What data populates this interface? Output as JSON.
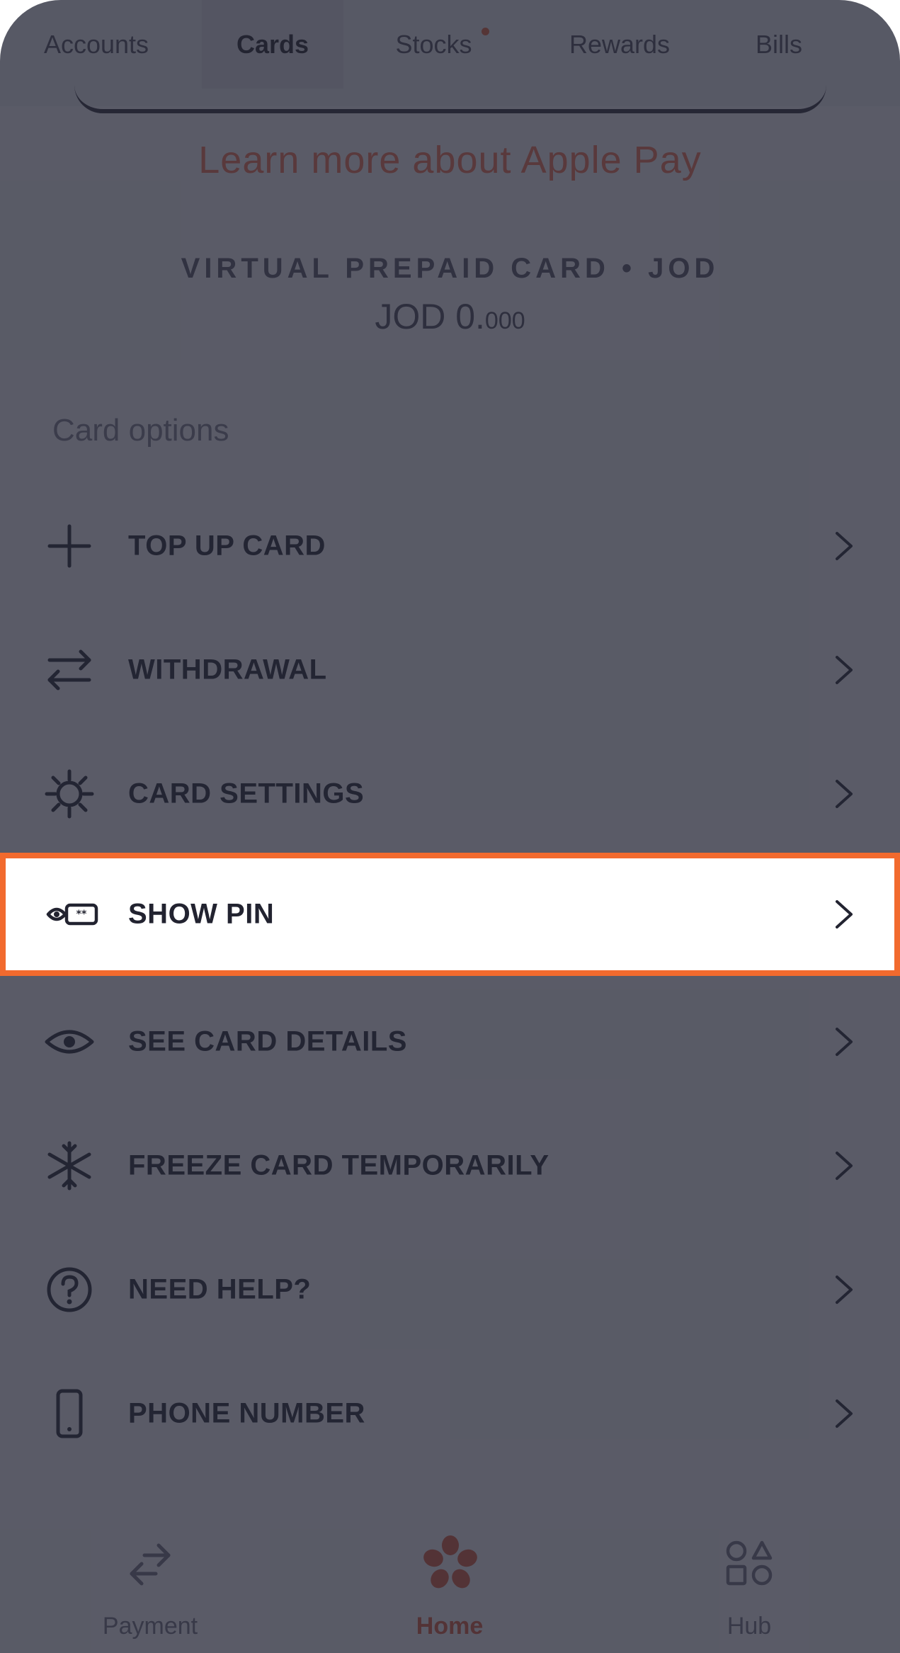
{
  "tabs": [
    {
      "label": "Accounts"
    },
    {
      "label": "Cards"
    },
    {
      "label": "Stocks"
    },
    {
      "label": "Rewards"
    },
    {
      "label": "Bills"
    }
  ],
  "card": {
    "apple_pay_link": "Learn more about Apple Pay",
    "type_label": "VIRTUAL PREPAID CARD  •  JOD",
    "balance_main": "JOD 0.",
    "balance_fraction": "000"
  },
  "card_options": {
    "title": "Card options",
    "items": [
      {
        "label": "TOP UP CARD",
        "icon": "plus-icon"
      },
      {
        "label": "WITHDRAWAL",
        "icon": "transfer-arrows-icon"
      },
      {
        "label": "CARD SETTINGS",
        "icon": "gear-icon"
      },
      {
        "label": "SHOW PIN",
        "icon": "pin-eye-icon"
      },
      {
        "label": "SEE CARD DETAILS",
        "icon": "eye-icon"
      },
      {
        "label": "FREEZE CARD TEMPORARILY",
        "icon": "snowflake-icon"
      },
      {
        "label": "NEED HELP?",
        "icon": "question-icon"
      },
      {
        "label": "PHONE NUMBER",
        "icon": "phone-icon"
      }
    ]
  },
  "bottom_nav": {
    "items": [
      {
        "label": "Payment",
        "icon": "payment-arrows-icon"
      },
      {
        "label": "Home",
        "icon": "home-flower-icon"
      },
      {
        "label": "Hub",
        "icon": "hub-shapes-icon"
      }
    ]
  },
  "colors": {
    "accent": "#f07152",
    "highlight_border": "#f26a2e",
    "overlay": "#242634"
  }
}
